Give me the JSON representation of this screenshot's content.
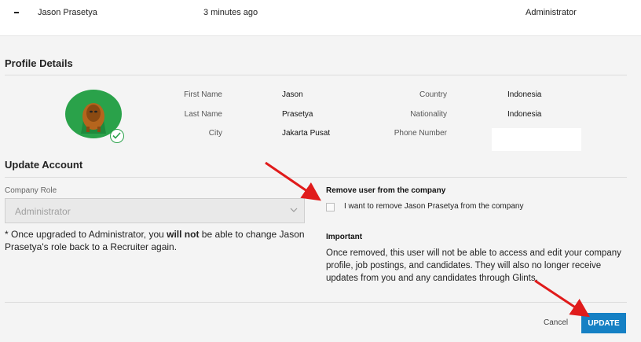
{
  "user_row": {
    "name": "Jason Prasetya",
    "time": "3 minutes ago",
    "role": "Administrator"
  },
  "profile": {
    "title": "Profile Details",
    "first_name_label": "First Name",
    "first_name": "Jason",
    "last_name_label": "Last Name",
    "last_name": "Prasetya",
    "city_label": "City",
    "city": "Jakarta Pusat",
    "country_label": "Country",
    "country": "Indonesia",
    "nationality_label": "Nationality",
    "nationality": "Indonesia",
    "phone_label": "Phone Number",
    "phone": ""
  },
  "update_account": {
    "title": "Update Account",
    "company_role_label": "Company Role",
    "company_role_value": "Administrator",
    "note_prefix": "* Once upgraded to Administrator, you ",
    "note_bold": "will not",
    "note_suffix": " be able to change Jason Prasetya's role back to a Recruiter again.",
    "remove_title": "Remove user from the company",
    "remove_checkbox_label": "I want to remove Jason Prasetya from the company",
    "important_title": "Important",
    "important_text": "Once removed, this user will not be able to access and edit your company profile, job postings, and candidates. They will also no longer receive updates from you and any candidates through Glints."
  },
  "actions": {
    "cancel_label": "Cancel",
    "update_label": "UPDATE"
  },
  "colors": {
    "accent": "#1580c4",
    "avatar_bg": "#2aa24a",
    "annotation_arrow": "#e01b1b"
  }
}
